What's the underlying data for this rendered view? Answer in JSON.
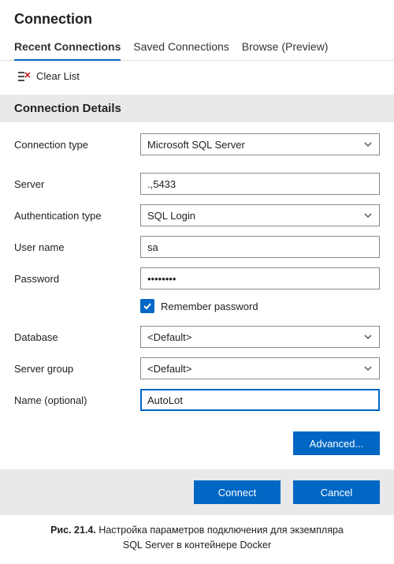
{
  "header": {
    "title": "Connection"
  },
  "tabs": {
    "recent": "Recent Connections",
    "saved": "Saved Connections",
    "browse": "Browse (Preview)"
  },
  "clear_list": "Clear List",
  "section": {
    "details_title": "Connection Details"
  },
  "fields": {
    "connection_type": {
      "label": "Connection type",
      "value": "Microsoft SQL Server"
    },
    "server": {
      "label": "Server",
      "value": ".,5433"
    },
    "auth_type": {
      "label": "Authentication type",
      "value": "SQL Login"
    },
    "user_name": {
      "label": "User name",
      "value": "sa"
    },
    "password": {
      "label": "Password",
      "value": "••••••••"
    },
    "remember": {
      "label": "Remember password",
      "checked": true
    },
    "database": {
      "label": "Database",
      "value": "<Default>"
    },
    "server_group": {
      "label": "Server group",
      "value": "<Default>"
    },
    "name": {
      "label": "Name (optional)",
      "value": "AutoLot"
    }
  },
  "buttons": {
    "advanced": "Advanced...",
    "connect": "Connect",
    "cancel": "Cancel"
  },
  "caption": {
    "bold": "Рис. 21.4.",
    "line1": " Настройка параметров подключения для экземпляра",
    "line2": "SQL Server в контейнере Docker"
  }
}
